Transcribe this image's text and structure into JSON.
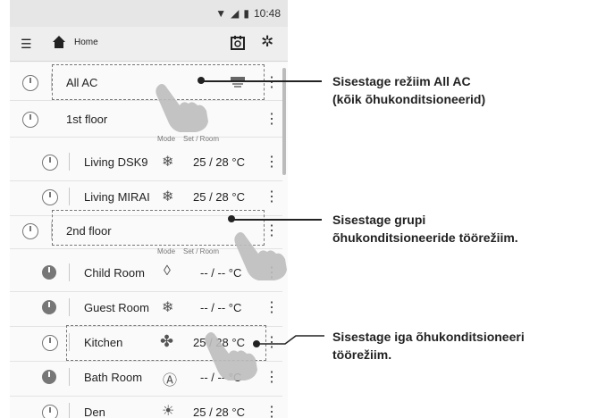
{
  "status": {
    "time": "10:48"
  },
  "header": {
    "title": "Home"
  },
  "columns": {
    "mode": "Mode",
    "set_room": "Set / Room"
  },
  "rows": [
    {
      "name": "All AC",
      "power": "on"
    },
    {
      "name": "1st floor",
      "power": "on"
    },
    {
      "name": "Living DSK9",
      "power": "on",
      "mode": "snowflake-icon",
      "temp": "25 / 28 °C"
    },
    {
      "name": "Living MIRAI",
      "power": "on",
      "mode": "snowflake-icon",
      "temp": "25 / 28 °C"
    },
    {
      "name": "2nd floor",
      "power": "on"
    },
    {
      "name": "Child Room",
      "power": "off",
      "mode": "drop-icon",
      "temp": "-- / --  °C"
    },
    {
      "name": "Guest Room",
      "power": "off",
      "mode": "snowflake-icon",
      "temp": "-- / --  °C"
    },
    {
      "name": "Kitchen",
      "power": "on",
      "mode": "fan-icon",
      "temp": "25 / 28 °C"
    },
    {
      "name": "Bath Room",
      "power": "off",
      "mode": "auto-icon",
      "temp": "-- / --  °C"
    },
    {
      "name": "Den",
      "power": "on",
      "mode": "sun-icon",
      "temp": "25 / 28 °C"
    }
  ],
  "callouts": [
    {
      "line1": "Sisestage režiim All AC",
      "line2": "(kõik õhukonditsioneerid)"
    },
    {
      "line1": "Sisestage grupi",
      "line2": "õhukonditsioneeride töörežiim."
    },
    {
      "line1": "Sisestage iga õhukonditsioneeri",
      "line2": "töörežiim."
    }
  ]
}
